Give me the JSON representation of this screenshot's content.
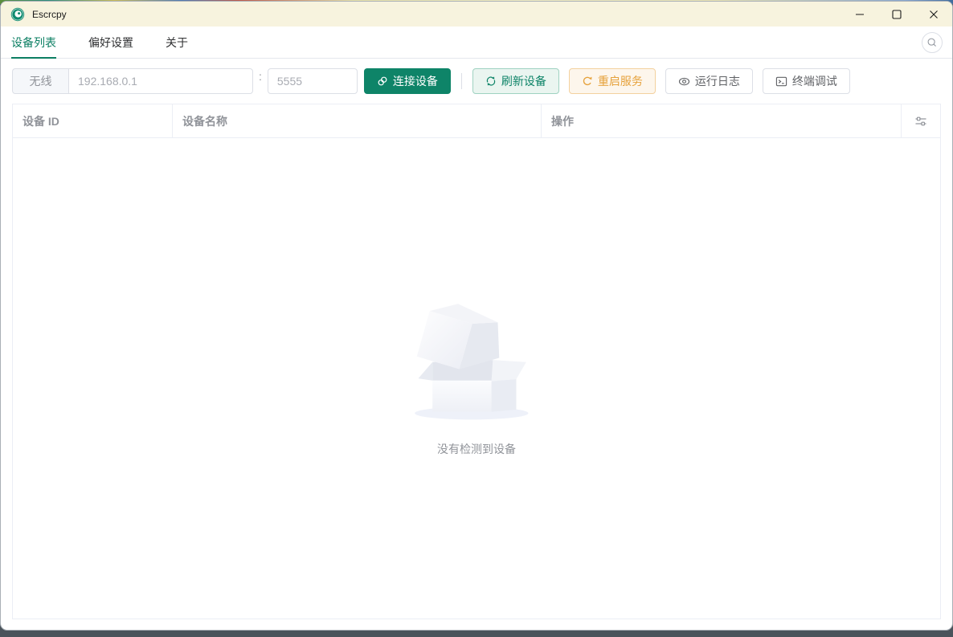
{
  "window": {
    "title": "Escrcpy"
  },
  "tabs": [
    {
      "label": "设备列表",
      "active": true
    },
    {
      "label": "偏好设置",
      "active": false
    },
    {
      "label": "关于",
      "active": false
    }
  ],
  "toolbar": {
    "wireless_label": "无线",
    "ip_placeholder": "192.168.0.1",
    "port_separator": ":",
    "port_placeholder": "5555",
    "connect_label": "连接设备",
    "refresh_label": "刷新设备",
    "restart_label": "重启服务",
    "logs_label": "运行日志",
    "terminal_label": "终端调试"
  },
  "table": {
    "columns": [
      "设备 ID",
      "设备名称",
      "操作"
    ],
    "rows": [],
    "empty_text": "没有检测到设备"
  },
  "icons": {
    "app_logo": "escrcpy-logo",
    "window": [
      "minimize",
      "maximize",
      "close"
    ],
    "search": "magnifier",
    "connect": "link-chain",
    "refresh": "refresh-circular-arrows",
    "restart": "refresh-right-arrow",
    "logs": "eye-view",
    "terminal": "terminal-monitor",
    "column_settings": "sliders"
  },
  "colors": {
    "primary": "#0e8468",
    "primary_dark": "#0c7f63",
    "success_light_bg": "#eaf5f0",
    "success_light_border": "#9fd2c1",
    "warning": "#e6a23c",
    "warning_light_bg": "#fdf6ec",
    "warning_light_border": "#f3d19e",
    "titlebar_bg": "#f7f3de",
    "header_text": "#909399",
    "border_light": "#ebeef5"
  }
}
